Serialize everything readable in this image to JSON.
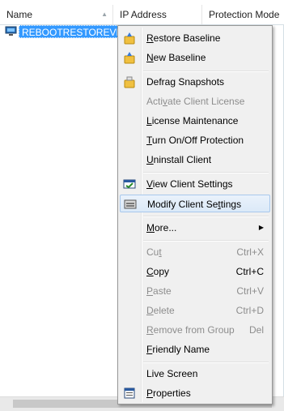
{
  "columns": {
    "name": "Name",
    "ip_address": "IP Address",
    "protection_mode": "Protection Mode"
  },
  "row": {
    "name": "REBOOTRESTOREVM"
  },
  "menu": {
    "restore_baseline": {
      "pre": "",
      "u": "R",
      "post": "estore Baseline"
    },
    "new_baseline": {
      "pre": "",
      "u": "N",
      "post": "ew Baseline"
    },
    "defrag_snapshots": {
      "pre": "Defrag Snapshots",
      "u": "",
      "post": ""
    },
    "activate_client_license": {
      "pre": "Acti",
      "u": "v",
      "post": "ate Client License"
    },
    "license_maintenance": {
      "pre": "",
      "u": "L",
      "post": "icense Maintenance"
    },
    "turn_on_off_protection": {
      "pre": "",
      "u": "T",
      "post": "urn On/Off Protection"
    },
    "uninstall_client": {
      "pre": "",
      "u": "U",
      "post": "ninstall Client"
    },
    "view_client_settings": {
      "pre": "",
      "u": "V",
      "post": "iew Client Settings"
    },
    "modify_client_settings": {
      "pre": "Modify Client Se",
      "u": "t",
      "post": "tings"
    },
    "more": {
      "pre": "",
      "u": "M",
      "post": "ore..."
    },
    "cut": {
      "pre": "Cu",
      "u": "t",
      "post": "",
      "shortcut": "Ctrl+X"
    },
    "copy": {
      "pre": "",
      "u": "C",
      "post": "opy",
      "shortcut": "Ctrl+C"
    },
    "paste": {
      "pre": "",
      "u": "P",
      "post": "aste",
      "shortcut": "Ctrl+V"
    },
    "delete": {
      "pre": "",
      "u": "D",
      "post": "elete",
      "shortcut": "Ctrl+D"
    },
    "remove_from_group": {
      "pre": "",
      "u": "R",
      "post": "emove from Group",
      "shortcut": "Del"
    },
    "friendly_name": {
      "pre": "",
      "u": "F",
      "post": "riendly Name"
    },
    "live_screen": {
      "pre": "Live Screen",
      "u": "",
      "post": ""
    },
    "properties": {
      "pre": "",
      "u": "P",
      "post": "roperties"
    }
  },
  "colors": {
    "selection": "#3399ff",
    "menu_background": "#f0f0f0",
    "highlight_border": "#a8c8ec"
  }
}
